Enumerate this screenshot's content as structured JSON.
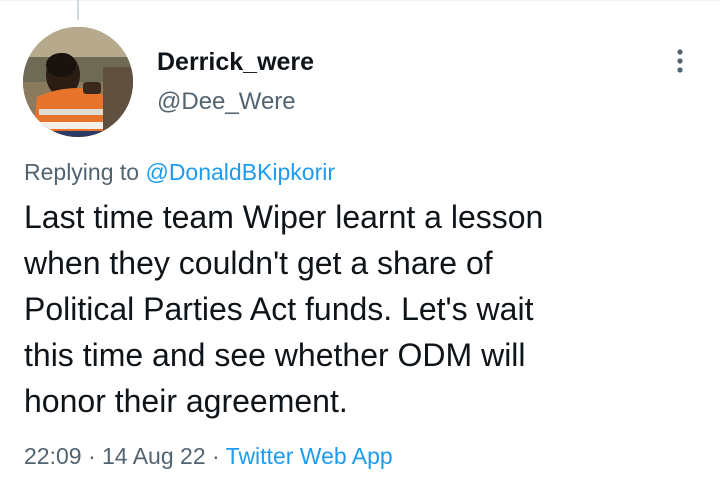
{
  "tweet": {
    "author": {
      "display_name": "Derrick_were",
      "handle": "@Dee_Were",
      "avatar_icon": "profile-photo"
    },
    "more_icon": "more-vertical-icon",
    "replying_to_label": "Replying to",
    "replying_to_handle": "@DonaldBKipkorir",
    "text_lines": [
      "Last time team Wiper learnt a lesson",
      "when they couldn't get a share of",
      "Political Parties Act funds. Let's wait",
      "this time and see whether ODM will",
      "honor their agreement."
    ],
    "time": "22:09",
    "separator": "·",
    "date": "14 Aug 22",
    "source": "Twitter Web App"
  },
  "colors": {
    "text_primary": "#0f1419",
    "text_secondary": "#536471",
    "link": "#1d9bf0"
  }
}
